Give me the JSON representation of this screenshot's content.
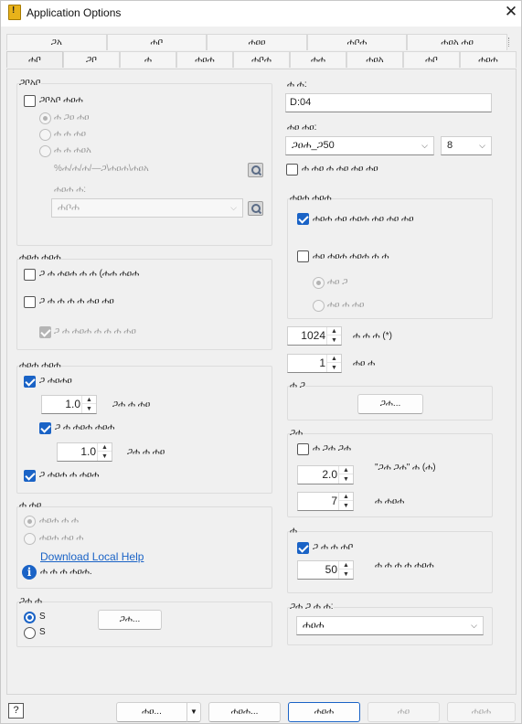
{
  "window": {
    "title": "Application Options",
    "icon": "app-warning-icon",
    "icon_glyph": "!",
    "close_glyph": "✕"
  },
  "tabs_row1": [
    "ጋአ",
    "ሐቦ",
    "ሐዐዐ",
    "ሐቦሐ",
    "ሐዐአ ሐዐ"
  ],
  "tabs_row2": [
    "ሐቦ",
    "ጋቦ",
    "ሐ",
    "ሐዐሐ",
    "ሐቦሐ",
    "ሐሐ",
    "ሐዐአ",
    "ሐቦ",
    "ሐዐሐ"
  ],
  "left": {
    "group1": {
      "label": "ጋቦአቦ",
      "check_label": "ጋቦአቦ ሐዐሐ",
      "radio1": "ሐ ጋዐ ሐዐ",
      "radio2": "ሐ ሐ ሐዐ",
      "radio3": "ሐ ሐ ሐዐአ",
      "path_value": "%ሐ/ሐ/ሐ/—ጋ\\ሐዐሐ\\ሐዐአ",
      "sub_label": "ሐዐሐ ሐ:",
      "combo_value": "ሐቦሐ"
    },
    "group2": {
      "label": "ሐዐሐ ሐዐሐ",
      "check1": "ጋ ሐ ሐዐሐ ሐ ሐ (ሐሐ ሐዐሐ",
      "check2": "ጋ ሐ ሐ ሐ ሐ ሐዐ ሐዐ",
      "check3": "ጋ ሐ ሐዐሐ ሐ ሐ ሐ ሐዐ"
    },
    "group3": {
      "label": "ሐዐሐ ሐዐሐ",
      "check1": "ጋ ሐዐሐዐ",
      "spin1": "1.0",
      "spin1_label": "ጋሐ ሐ ሐዐ",
      "check2": "ጋ ሐ ሐዐሐ ሐዐሐ",
      "spin2": "1.0",
      "spin2_label": "ጋሐ ሐ ሐዐ",
      "check3": "ጋ ሐዐሐ ሐ ሐዐሐ"
    },
    "group4": {
      "label": "ሐ ሐዐ",
      "radio1": "ሐዐሐ ሐ ሐ",
      "radio2": "ሐዐሐ ሐዐ ሐ",
      "link": "Download Local Help",
      "info_text": "ሐ ሐ ሐ ሐዐሐ."
    },
    "group5": {
      "label": "ጋሐ ሐ",
      "radio1": "S",
      "radio2": "S",
      "button": "ጋሐ..."
    }
  },
  "right": {
    "field1_label": "ሐ ሐ:",
    "field1_value": "D:04",
    "font_label": "ሐዐ ሐዐ:",
    "font_combo": "ጋዐሐ_ጋ50",
    "size_combo": "8",
    "font_check": "ሐ ሐዐ ሐ ሐዐ ሐዐ ሐዐ",
    "group_a": {
      "label": "ሐዐሐ ሐዐሐ",
      "check1": "ሐዐሐ ሐዐ ሐዐሐ ሐዐ ሐዐ ሐዐ",
      "check2": "ሐዐ ሐዐሐ ሐዐሐ ሐ ሐ",
      "radio1": "ሐዐ ጋ",
      "radio2": "ሐዐ ሐ ሐዐ"
    },
    "spin_a": "1024",
    "spin_a_label": "ሐ ሐ ሐ (*)",
    "spin_b": "1",
    "spin_b_label": "ሐዐ ሐ",
    "group_b": {
      "label": "ሐ ጋ",
      "button": "ጋሐ..."
    },
    "group_c": {
      "label": "ጋሐ",
      "check": "ሐ ጋሐ ጋሐ",
      "spin1": "2.0",
      "spin1_label": "\"ጋሐ ጋሐ\" ሐ (ሐ)",
      "spin2": "7",
      "spin2_label": "ሐ ሐዐሐ"
    },
    "group_d": {
      "label": "ሐ",
      "check": "ጋ ሐ ሐ ሐቦ",
      "spin": "50",
      "spin_label": "ሐ ሐ ሐ ሐ ሐዐሐ"
    },
    "bottom_label": "ጋሐ ጋ ሐ ሐ:",
    "bottom_combo": "ሐዐሐ"
  },
  "footer": {
    "help_glyph": "?",
    "btn1": "ሐዐ...",
    "btn2": "ሐዐሐ...",
    "btn3": "ሐዐሐ",
    "btn4": "ሐዐ",
    "btn5": "ሐዐሐ",
    "dropdown_glyph": "▼"
  },
  "colors": {
    "accent": "#1a63c6",
    "background": "#f0f0f0"
  }
}
